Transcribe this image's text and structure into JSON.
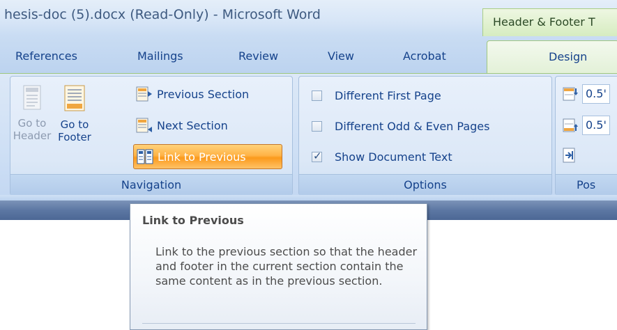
{
  "window": {
    "title": "hesis-doc (5).docx (Read-Only) - Microsoft Word",
    "context_tab": "Header & Footer T"
  },
  "tabs": {
    "references": "References",
    "mailings": "Mailings",
    "review": "Review",
    "view": "View",
    "acrobat": "Acrobat",
    "design": "Design"
  },
  "navigation": {
    "go_to_header_line1": "Go to",
    "go_to_header_line2": "Header",
    "go_to_footer_line1": "Go to",
    "go_to_footer_line2": "Footer",
    "previous_section": "Previous Section",
    "next_section": "Next Section",
    "link_to_previous": "Link to Previous",
    "group_label": "Navigation"
  },
  "options": {
    "different_first_page": {
      "label": "Different First Page",
      "checked": false
    },
    "different_odd_even": {
      "label": "Different Odd & Even Pages",
      "checked": false
    },
    "show_document_text": {
      "label": "Show Document Text",
      "checked": true
    },
    "group_label": "Options"
  },
  "position": {
    "header_from_top": "0.5'",
    "footer_from_bottom": "0.5'",
    "group_label": "Pos"
  },
  "tooltip": {
    "title": "Link to Previous",
    "body": "Link to the previous section so that the header and footer in the current section contain the same content as in the previous section."
  },
  "colors": {
    "ribbon_bg": "#dce8f7",
    "highlight": "#fb9a1c",
    "context_tab": "#d6ecc0",
    "text": "#15428b"
  }
}
